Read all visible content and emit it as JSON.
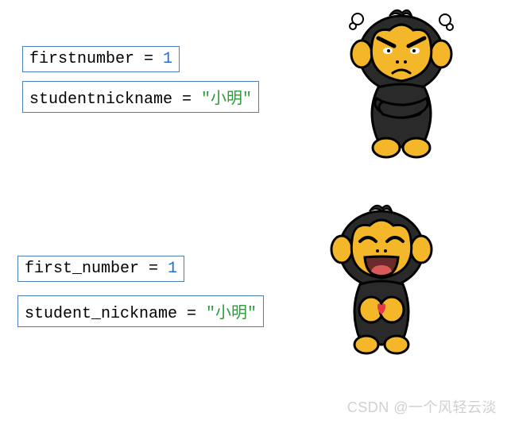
{
  "bad_example": {
    "line1": {
      "var": "firstnumber",
      "eq": " = ",
      "val": "1",
      "type": "number"
    },
    "line2": {
      "var": "studentnickname",
      "eq": " = ",
      "val": "\"小明\"",
      "type": "string"
    }
  },
  "good_example": {
    "line1": {
      "var": "first_number",
      "eq": " = ",
      "val": "1",
      "type": "number"
    },
    "line2": {
      "var": "student_nickname",
      "eq": " = ",
      "val": "\"小明\"",
      "type": "string"
    }
  },
  "watermark": "CSDN @一个风轻云淡",
  "mascots": {
    "angry": "angry-monkey",
    "happy": "happy-monkey"
  }
}
